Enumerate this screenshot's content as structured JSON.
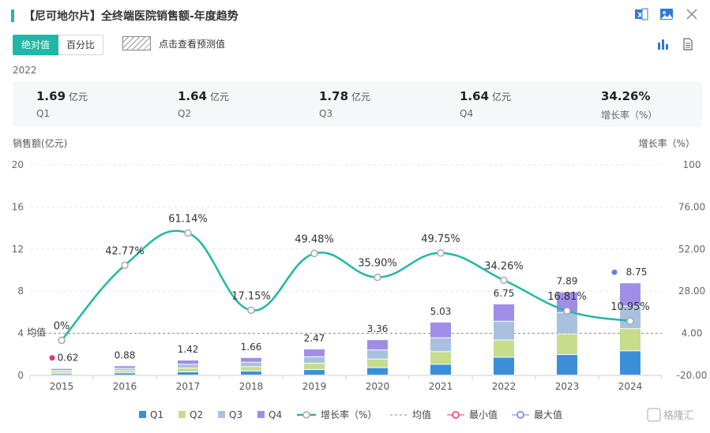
{
  "header": {
    "title": "【尼可地尔片】全终端医院销售额-年度趋势"
  },
  "toolbar": {
    "absolute_label": "绝对值",
    "percent_label": "百分比",
    "forecast_label": "点击查看预测值"
  },
  "summary": {
    "year": "2022",
    "items": [
      {
        "value": "1.69",
        "unit": "亿元",
        "label": "Q1"
      },
      {
        "value": "1.64",
        "unit": "亿元",
        "label": "Q2"
      },
      {
        "value": "1.78",
        "unit": "亿元",
        "label": "Q3"
      },
      {
        "value": "1.64",
        "unit": "亿元",
        "label": "Q4"
      },
      {
        "value": "34.26%",
        "unit": "",
        "label": "增长率（%）"
      }
    ]
  },
  "colors": {
    "accent": "#1fb8a6",
    "q1": "#3b8fd9",
    "q2": "#c6dd8c",
    "q3": "#a9c1df",
    "q4": "#a08de8",
    "min": "#e8336b",
    "max": "#6a7de0"
  },
  "chart_data": {
    "type": "bar",
    "stacked": true,
    "categories": [
      "2015",
      "2016",
      "2017",
      "2018",
      "2019",
      "2020",
      "2021",
      "2022",
      "2023",
      "2024"
    ],
    "series": [
      {
        "name": "Q1",
        "values": [
          0.13,
          0.2,
          0.3,
          0.38,
          0.52,
          0.7,
          1.02,
          1.69,
          1.95,
          2.3
        ]
      },
      {
        "name": "Q2",
        "values": [
          0.16,
          0.22,
          0.36,
          0.42,
          0.6,
          0.82,
          1.2,
          1.64,
          1.95,
          2.1
        ]
      },
      {
        "name": "Q3",
        "values": [
          0.16,
          0.22,
          0.36,
          0.42,
          0.62,
          0.86,
          1.32,
          1.78,
          2.04,
          2.15
        ]
      },
      {
        "name": "Q4",
        "values": [
          0.17,
          0.24,
          0.4,
          0.44,
          0.73,
          0.98,
          1.49,
          1.64,
          1.95,
          2.2
        ]
      }
    ],
    "totals": [
      0.62,
      0.88,
      1.42,
      1.66,
      2.47,
      3.36,
      5.03,
      6.75,
      7.89,
      8.75
    ],
    "growth": {
      "name": "增长率（%）",
      "values": [
        0,
        42.77,
        61.14,
        17.15,
        49.48,
        35.9,
        49.75,
        34.26,
        16.81,
        10.95
      ],
      "labels": [
        "0%",
        "42.77%",
        "61.14%",
        "17.15%",
        "49.48%",
        "35.90%",
        "49.75%",
        "34.26%",
        "16.81%",
        "10.95%"
      ]
    },
    "average": {
      "name": "均值",
      "label": "均值",
      "value": 4.0
    },
    "min": {
      "name": "最小值"
    },
    "max": {
      "name": "最大值"
    },
    "ylabel_left": "销售额(亿元)",
    "ylabel_right": "增长率（%）",
    "ylim_left": [
      0,
      20
    ],
    "yticks_left": [
      "0",
      "4",
      "8",
      "12",
      "16",
      "20"
    ],
    "ylim_right": [
      -20,
      100
    ],
    "yticks_right": [
      "-20.00",
      "4.00",
      "28.00",
      "52.00",
      "76.00",
      "100"
    ],
    "legend_position": "bottom"
  },
  "watermark": "格隆汇"
}
